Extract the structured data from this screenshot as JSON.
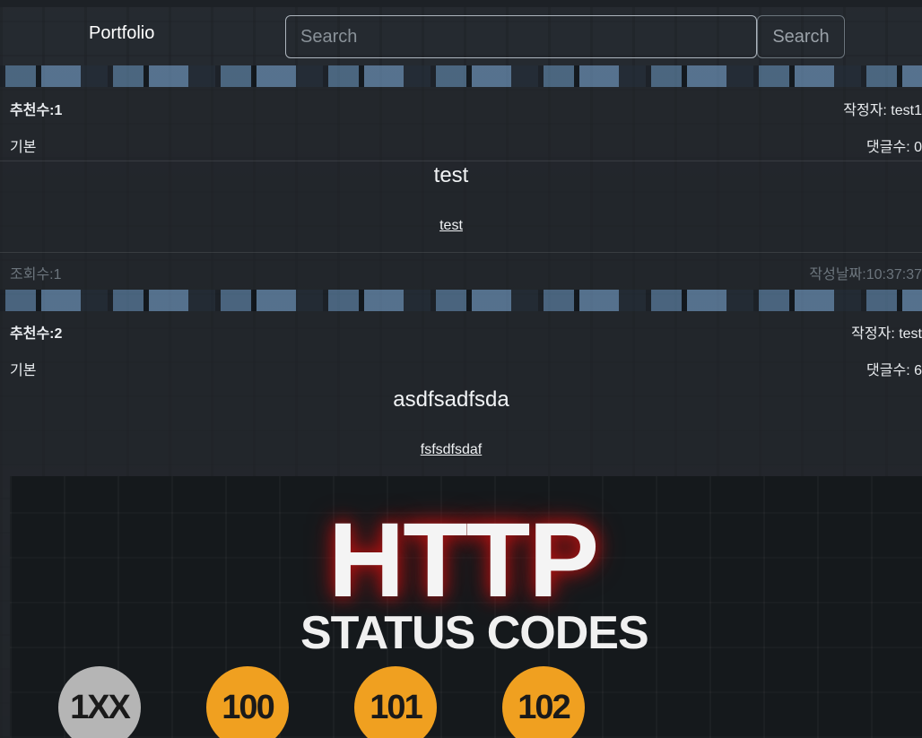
{
  "navbar": {
    "brand": "Portfolio",
    "search_placeholder": "Search",
    "search_button": "Search"
  },
  "posts": [
    {
      "likes": "추천수:1",
      "author": "작정자: test1",
      "category": "기본",
      "comments": "댓글수: 0",
      "title": "test",
      "body": "test",
      "views": "조회수:1",
      "date": "작성날짜:10:37:37"
    },
    {
      "likes": "추천수:2",
      "author": "작정자: test",
      "category": "기본",
      "comments": "댓글수: 6",
      "title": "asdfsadfsda",
      "body": "fsfsdfsdaf"
    }
  ],
  "image": {
    "title": "HTTP",
    "subtitle": "STATUS CODES",
    "codes": [
      {
        "label": "1XX",
        "color": "#b5b5b5"
      },
      {
        "label": "100",
        "color": "#f0a020"
      },
      {
        "label": "101",
        "color": "#f0a020"
      },
      {
        "label": "102",
        "color": "#f0a020"
      }
    ]
  }
}
